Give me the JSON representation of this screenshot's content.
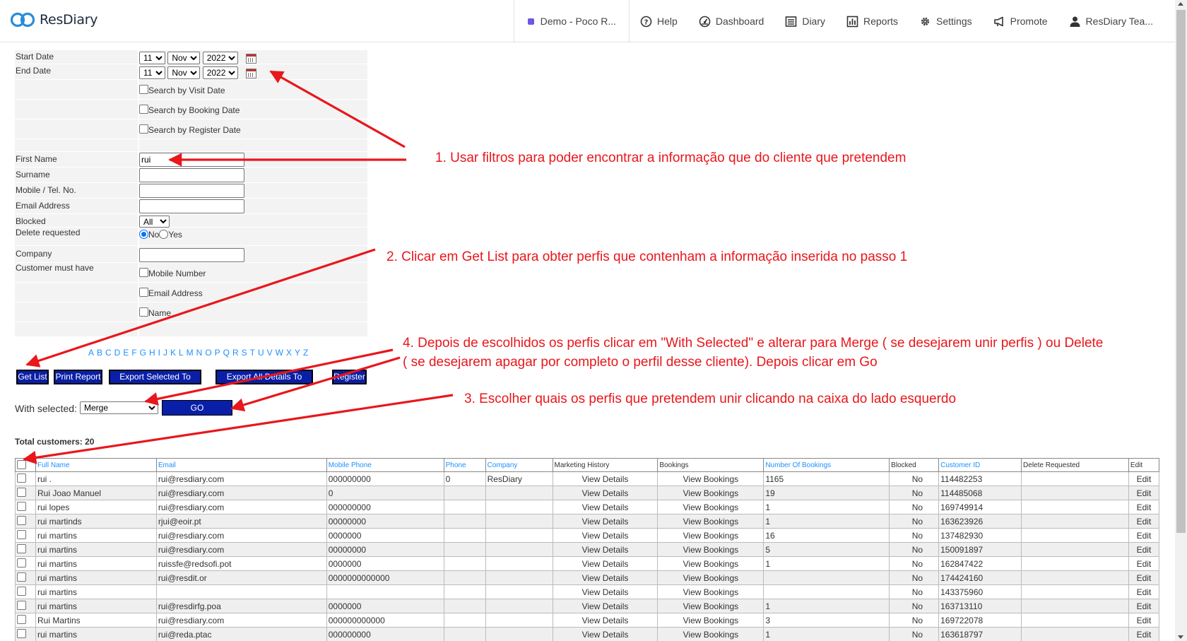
{
  "header": {
    "logo_text": "ResDiary",
    "nav": {
      "demo": "Demo - Poco R...",
      "help": "Help",
      "dashboard": "Dashboard",
      "diary": "Diary",
      "reports": "Reports",
      "settings": "Settings",
      "promote": "Promote",
      "user": "ResDiary Tea..."
    },
    "colors": {
      "demo_dot": "#6a5ae0",
      "brand": "#2a8bd8"
    }
  },
  "filters": {
    "start_date": {
      "label": "Start Date",
      "day": "11",
      "month": "Nov",
      "year": "2022"
    },
    "end_date": {
      "label": "End Date",
      "day": "11",
      "month": "Nov",
      "year": "2022"
    },
    "search_visit": "Search by Visit Date",
    "search_booking": "Search by Booking Date",
    "search_register": "Search by Register Date",
    "first_name": {
      "label": "First Name",
      "value": "rui"
    },
    "surname": {
      "label": "Surname",
      "value": ""
    },
    "mobile": {
      "label": "Mobile / Tel. No.",
      "value": ""
    },
    "email": {
      "label": "Email Address",
      "value": ""
    },
    "blocked": {
      "label": "Blocked",
      "value": "All"
    },
    "delete_requested": {
      "label": "Delete requested",
      "no": "No",
      "yes": "Yes"
    },
    "company": {
      "label": "Company",
      "value": ""
    },
    "must_have": {
      "label": "Customer must have",
      "mobile": "Mobile Number",
      "email": "Email Address",
      "name": "Name"
    }
  },
  "alphabet": [
    "A",
    "B",
    "C",
    "D",
    "E",
    "F",
    "G",
    "H",
    "I",
    "J",
    "K",
    "L",
    "M",
    "N",
    "O",
    "P",
    "Q",
    "R",
    "S",
    "T",
    "U",
    "V",
    "W",
    "X",
    "Y",
    "Z"
  ],
  "buttons": {
    "get_list": "Get List",
    "print_report": "Print Report",
    "export_selected": "Export Selected To CSV",
    "export_all": "Export All Details To CSV",
    "register": "Register",
    "go": "GO"
  },
  "with_selected": {
    "label": "With selected:",
    "value": "Merge"
  },
  "total_customers": "Total customers: 20",
  "table": {
    "headers": [
      "Full Name",
      "Email",
      "Mobile Phone",
      "Phone",
      "Company",
      "Marketing History",
      "Bookings",
      "Number Of Bookings",
      "Blocked",
      "Customer ID",
      "Delete Requested",
      "Edit"
    ],
    "rows": [
      {
        "name": "rui .",
        "email": "rui@resdiary.com",
        "mobile": "000000000",
        "phone": "0",
        "company": "ResDiary",
        "marketing": "View Details",
        "bookings": "View Bookings",
        "count": "1165",
        "blocked": "No",
        "id": "114482253",
        "edit": "Edit"
      },
      {
        "name": "Rui Joao Manuel",
        "email": "rui@resdiary.com",
        "mobile": "0",
        "phone": "",
        "company": "",
        "marketing": "View Details",
        "bookings": "View Bookings",
        "count": "19",
        "blocked": "No",
        "id": "114485068",
        "edit": "Edit"
      },
      {
        "name": "rui lopes",
        "email": "rui@resdiary.com",
        "mobile": "000000000",
        "phone": "",
        "company": "",
        "marketing": "View Details",
        "bookings": "View Bookings",
        "count": "1",
        "blocked": "No",
        "id": "169749914",
        "edit": "Edit"
      },
      {
        "name": "rui martinds",
        "email": "rjui@eoir.pt",
        "mobile": "00000000",
        "phone": "",
        "company": "",
        "marketing": "View Details",
        "bookings": "View Bookings",
        "count": "1",
        "blocked": "No",
        "id": "163623926",
        "edit": "Edit"
      },
      {
        "name": "rui martins",
        "email": "rui@resdiary.com",
        "mobile": "0000000",
        "phone": "",
        "company": "",
        "marketing": "View Details",
        "bookings": "View Bookings",
        "count": "16",
        "blocked": "No",
        "id": "137482930",
        "edit": "Edit"
      },
      {
        "name": "rui martins",
        "email": "rui@resdiary.com",
        "mobile": "00000000",
        "phone": "",
        "company": "",
        "marketing": "View Details",
        "bookings": "View Bookings",
        "count": "5",
        "blocked": "No",
        "id": "150091897",
        "edit": "Edit"
      },
      {
        "name": "rui martins",
        "email": "ruissfe@redsofi.pot",
        "mobile": "0000000",
        "phone": "",
        "company": "",
        "marketing": "View Details",
        "bookings": "View Bookings",
        "count": "1",
        "blocked": "No",
        "id": "162847422",
        "edit": "Edit"
      },
      {
        "name": "rui martins",
        "email": "rui@resdit.or",
        "mobile": "0000000000000",
        "phone": "",
        "company": "",
        "marketing": "View Details",
        "bookings": "View Bookings",
        "count": "",
        "blocked": "No",
        "id": "174424160",
        "edit": "Edit"
      },
      {
        "name": "rui martins",
        "email": "",
        "mobile": "",
        "phone": "",
        "company": "",
        "marketing": "View Details",
        "bookings": "View Bookings",
        "count": "",
        "blocked": "No",
        "id": "143375960",
        "edit": "Edit"
      },
      {
        "name": "rui martins",
        "email": "rui@resdirfg.poa",
        "mobile": "0000000",
        "phone": "",
        "company": "",
        "marketing": "View Details",
        "bookings": "View Bookings",
        "count": "1",
        "blocked": "No",
        "id": "163713110",
        "edit": "Edit"
      },
      {
        "name": "Rui Martins",
        "email": "rui@resdiary.com",
        "mobile": "000000000000",
        "phone": "",
        "company": "",
        "marketing": "View Details",
        "bookings": "View Bookings",
        "count": "3",
        "blocked": "No",
        "id": "169722078",
        "edit": "Edit"
      },
      {
        "name": "rui martins",
        "email": "rui@reda.ptac",
        "mobile": "000000000",
        "phone": "",
        "company": "",
        "marketing": "View Details",
        "bookings": "View Bookings",
        "count": "1",
        "blocked": "No",
        "id": "163618797",
        "edit": "Edit"
      }
    ]
  },
  "annotations": {
    "step1": "1. Usar filtros para poder encontrar a informação que do cliente que pretendem",
    "step2": "2. Clicar em Get List para obter perfis que contenham a informação inserida no passo 1",
    "step4_line1": "4. Depois de escolhidos os perfis clicar em \"With Selected\" e alterar para Merge ( se desejarem unir perfis ) ou Delete",
    "step4_line2": "( se desejarem apagar por completo o perfil desse cliente). Depois clicar em Go",
    "step3": "3. Escolher quais os perfis que pretendem unir clicando na caixa do lado esquerdo",
    "color": "#e8171c"
  }
}
